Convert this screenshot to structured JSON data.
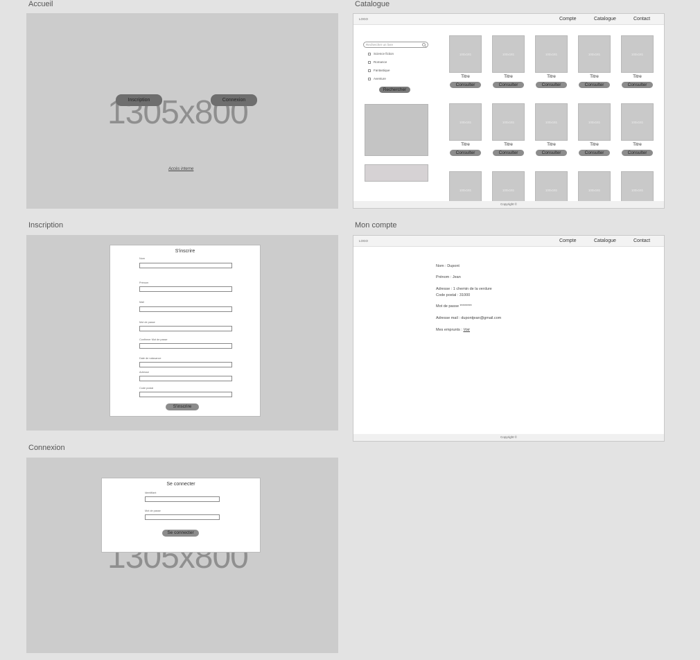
{
  "frames": {
    "accueil": "Accueil",
    "catalogue": "Catalogue",
    "inscription": "Inscription",
    "compte": "Mon compte",
    "connexion": "Connexion"
  },
  "placeholder_size": "1305x800",
  "accueil": {
    "inscription_button": "Inscription",
    "connexion_button": "Connexion",
    "internal_access_link": "Accès interne"
  },
  "nav": {
    "logo": "LOGO",
    "compte": "Compte",
    "catalogue": "Catalogue",
    "contact": "Contact"
  },
  "footer": "Copyright ©",
  "catalogue": {
    "search_placeholder": "Rechercher un livre",
    "genres": [
      "Science fiction",
      "Romance",
      "Fantastique",
      "Aventure"
    ],
    "search_button": "Rechercher",
    "thumb_size": "100x181",
    "book_title": "Titre",
    "consult_button": "Consulter"
  },
  "inscription": {
    "title": "S'inscrire",
    "fields": [
      "Nom",
      "Prénom",
      "Mail",
      "Mot de passe",
      "Confirmer Mot de passe",
      "Date de naissance",
      "Adresse",
      "Code postal"
    ],
    "submit_button": "S'inscrire"
  },
  "connexion": {
    "title": "Se connecter",
    "fields": [
      "Identifiant",
      "Mot de passe"
    ],
    "submit_button": "Se connecter"
  },
  "compte": {
    "nom": "Nom : Dupont",
    "prenom": "Prénom : Jean",
    "adresse": "Adresse : 1 chemin de la verdure",
    "code_postal": "Code postal : 31000",
    "mot_de_passe": "Mot de passe ********",
    "mail": "Adresse mail : dupontjean@gmail.com",
    "emprunts_label": "Mes emprunts :",
    "emprunts_link": "Voir"
  }
}
